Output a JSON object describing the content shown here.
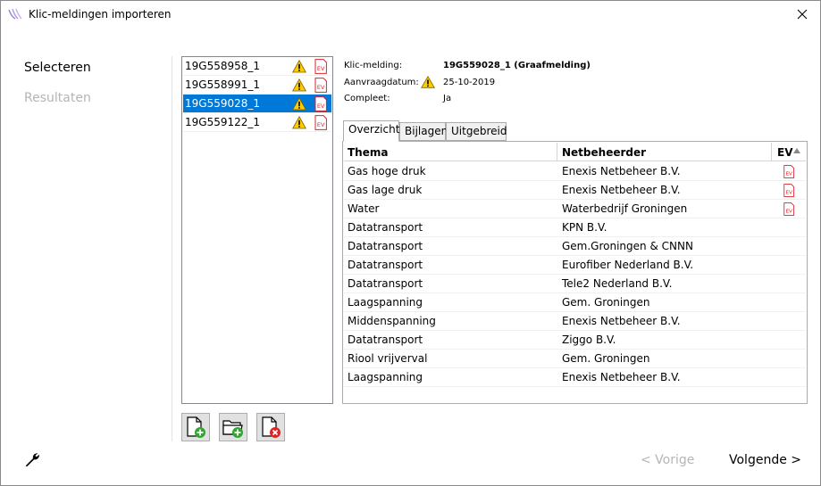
{
  "window": {
    "title": "Klic-meldingen importeren"
  },
  "nav": {
    "select": "Selecteren",
    "results": "Resultaten"
  },
  "meldingen": [
    {
      "id": "19G558958_1",
      "selected": false
    },
    {
      "id": "19G558991_1",
      "selected": false
    },
    {
      "id": "19G559028_1",
      "selected": true
    },
    {
      "id": "19G559122_1",
      "selected": false
    }
  ],
  "details": {
    "melding_label": "Klic-melding:",
    "melding_value": "19G559028_1 (Graafmelding)",
    "datum_label": "Aanvraagdatum:",
    "datum_value": "25-10-2019",
    "compleet_label": "Compleet:",
    "compleet_value": "Ja"
  },
  "tabs": [
    {
      "label": "Overzicht",
      "active": true
    },
    {
      "label": "Bijlagen",
      "active": false
    },
    {
      "label": "Uitgebreid",
      "active": false
    }
  ],
  "grid": {
    "headers": {
      "thema": "Thema",
      "netbeheerder": "Netbeheerder",
      "ev": "EV"
    },
    "rows": [
      {
        "thema": "Gas hoge druk",
        "netbeheerder": "Enexis Netbeheer B.V.",
        "ev": true
      },
      {
        "thema": "Gas lage druk",
        "netbeheerder": "Enexis Netbeheer B.V.",
        "ev": true
      },
      {
        "thema": "Water",
        "netbeheerder": "Waterbedrijf Groningen",
        "ev": true
      },
      {
        "thema": "Datatransport",
        "netbeheerder": "KPN B.V.",
        "ev": false
      },
      {
        "thema": "Datatransport",
        "netbeheerder": "Gem.Groningen & CNNN",
        "ev": false
      },
      {
        "thema": "Datatransport",
        "netbeheerder": "Eurofiber Nederland B.V.",
        "ev": false
      },
      {
        "thema": "Datatransport",
        "netbeheerder": "Tele2 Nederland B.V.",
        "ev": false
      },
      {
        "thema": "Laagspanning",
        "netbeheerder": "Gem. Groningen",
        "ev": false
      },
      {
        "thema": "Middenspanning",
        "netbeheerder": "Enexis Netbeheer B.V.",
        "ev": false
      },
      {
        "thema": "Datatransport",
        "netbeheerder": "Ziggo B.V.",
        "ev": false
      },
      {
        "thema": "Riool vrijverval",
        "netbeheerder": "Gem. Groningen",
        "ev": false
      },
      {
        "thema": "Laagspanning",
        "netbeheerder": "Enexis Netbeheer B.V.",
        "ev": false
      }
    ]
  },
  "footer": {
    "prev": "< Vorige",
    "next": "Volgende >"
  },
  "icons": {
    "warning": "warning-icon",
    "ev": "ev-document-icon",
    "add_file": "add-file-icon",
    "add_folder": "add-folder-icon",
    "remove_file": "remove-file-icon",
    "settings": "wrench-icon"
  },
  "colors": {
    "selection": "#0078d7",
    "disabled_text": "#b5b5b5",
    "warning": "#ffcc00",
    "ev_red": "#d9262c"
  }
}
